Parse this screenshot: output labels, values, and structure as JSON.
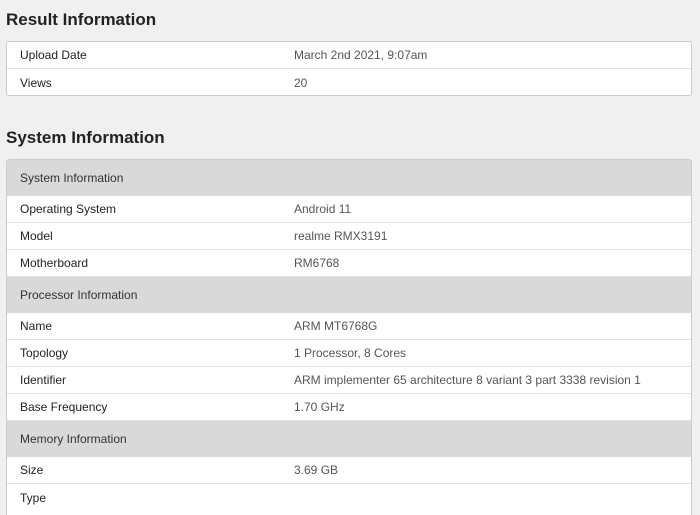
{
  "result": {
    "title": "Result Information",
    "rows": [
      {
        "label": "Upload Date",
        "value": "March 2nd 2021, 9:07am"
      },
      {
        "label": "Views",
        "value": "20"
      }
    ]
  },
  "system": {
    "title": "System Information",
    "groups": [
      {
        "header": "System Information",
        "rows": [
          {
            "label": "Operating System",
            "value": "Android 11"
          },
          {
            "label": "Model",
            "value": "realme RMX3191"
          },
          {
            "label": "Motherboard",
            "value": "RM6768"
          }
        ]
      },
      {
        "header": "Processor Information",
        "rows": [
          {
            "label": "Name",
            "value": "ARM MT6768G"
          },
          {
            "label": "Topology",
            "value": "1 Processor, 8 Cores"
          },
          {
            "label": "Identifier",
            "value": "ARM implementer 65 architecture 8 variant 3 part 3338 revision 1"
          },
          {
            "label": "Base Frequency",
            "value": "1.70 GHz"
          }
        ]
      },
      {
        "header": "Memory Information",
        "rows": [
          {
            "label": "Size",
            "value": "3.69 GB"
          },
          {
            "label": "Type",
            "value": ""
          }
        ]
      }
    ]
  }
}
